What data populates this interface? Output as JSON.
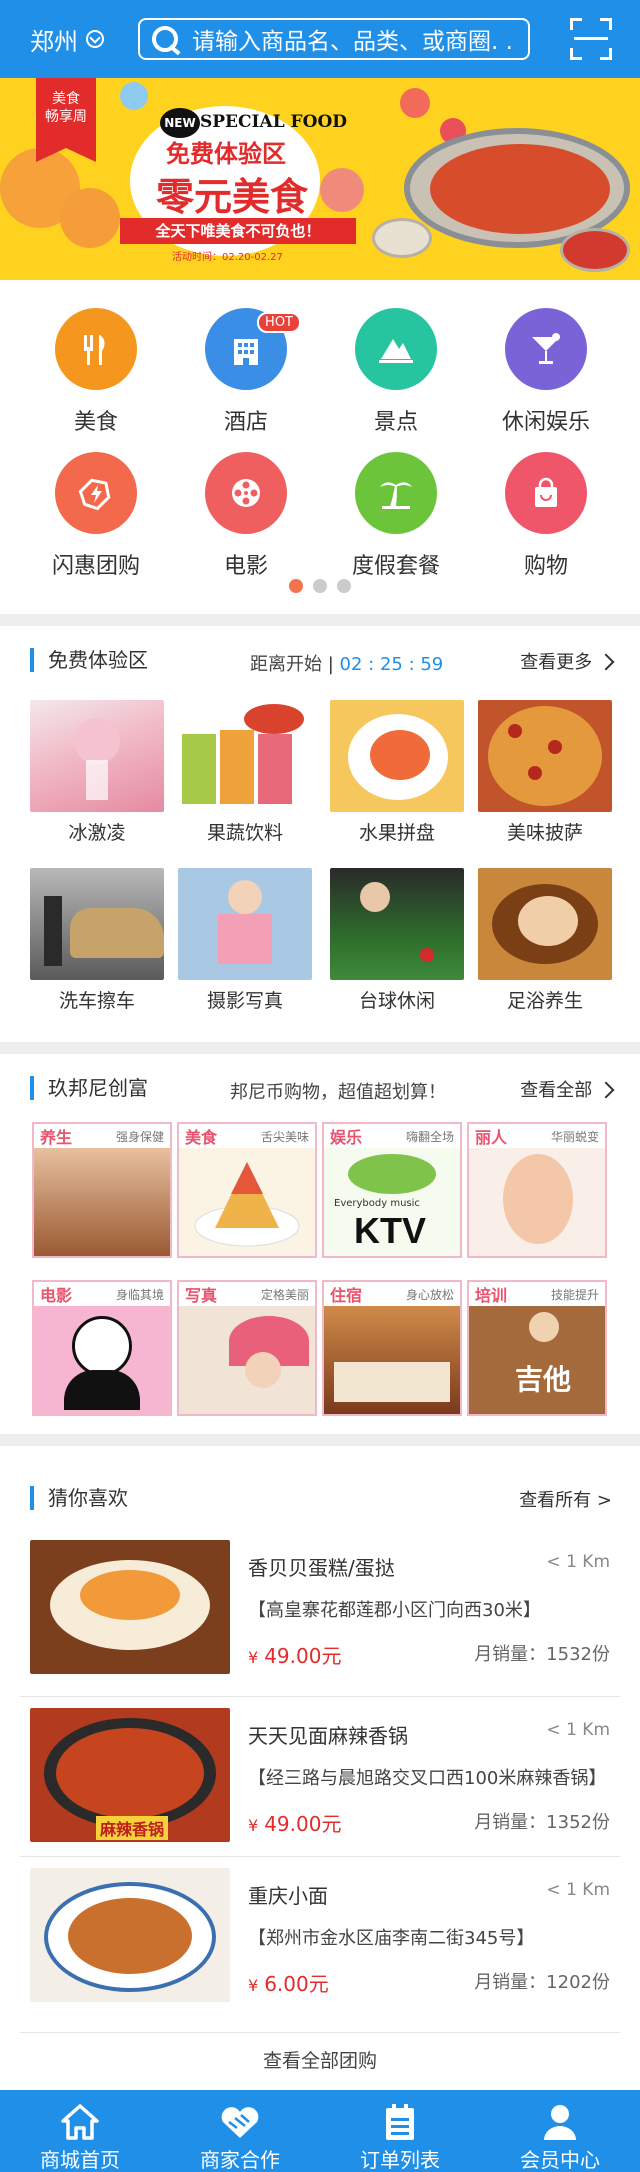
{
  "header": {
    "city": "郑州",
    "search_placeholder": "请输入商品名、品类、或商圈. . ."
  },
  "banner": {
    "tag": "美食畅享周",
    "tag_line1": "美食",
    "tag_line2": "畅享周",
    "new_badge": "NEW",
    "special": "SPECIAL FOOD",
    "free": "免费体验区",
    "headline": "零元美食",
    "ribbon": "全天下唯美食不可负也！",
    "date": "活动时间：02.20-02.27"
  },
  "categories": [
    {
      "label": "美食",
      "icon": "cutlery-icon",
      "color": "#f5961e"
    },
    {
      "label": "酒店",
      "icon": "hotel-icon",
      "color": "#3a8ee6",
      "badge": "HOT"
    },
    {
      "label": "景点",
      "icon": "scenery-icon",
      "color": "#27c4a0"
    },
    {
      "label": "休闲娱乐",
      "icon": "cocktail-icon",
      "color": "#7a63d6"
    },
    {
      "label": "闪惠团购",
      "icon": "flash-deal-icon",
      "color": "#f26a4b"
    },
    {
      "label": "电影",
      "icon": "film-reel-icon",
      "color": "#ef5f5f"
    },
    {
      "label": "度假套餐",
      "icon": "palm-tree-icon",
      "color": "#6cc43a"
    },
    {
      "label": "购物",
      "icon": "shopping-bag-icon",
      "color": "#f0566a"
    }
  ],
  "free_section": {
    "title": "免费体验区",
    "countdown_label": "距离开始",
    "countdown": "02 : 25 : 59",
    "more": "查看更多",
    "items": [
      {
        "label": "冰激凌",
        "color": "#e7a9b9"
      },
      {
        "label": "果蔬饮料",
        "color": "#f0b45a"
      },
      {
        "label": "水果拼盘",
        "color": "#f3c97a"
      },
      {
        "label": "美味披萨",
        "color": "#d86a3a"
      },
      {
        "label": "洗车擦车",
        "color": "#707276"
      },
      {
        "label": "摄影写真",
        "color": "#7aa8d8"
      },
      {
        "label": "台球休闲",
        "color": "#3b7a3a"
      },
      {
        "label": "足浴养生",
        "color": "#b5722f"
      }
    ]
  },
  "rich_section": {
    "title": "玖邦尼创富",
    "slogan": "邦尼币购物，超值超划算！",
    "more": "查看全部",
    "items": [
      {
        "title": "养生",
        "sub": "强身保健",
        "title_color": "#e8536e",
        "color": "#c98a5c"
      },
      {
        "title": "美食",
        "sub": "舌尖美味",
        "title_color": "#e8536e",
        "color": "#e9d2a0"
      },
      {
        "title": "娱乐",
        "sub": "嗨翻全场",
        "title_color": "#e8536e",
        "color": "#d7f0c8"
      },
      {
        "title": "丽人",
        "sub": "华丽蜕变",
        "title_color": "#e8536e",
        "color": "#f4c7a8"
      },
      {
        "title": "电影",
        "sub": "身临其境",
        "title_color": "#e8536e",
        "color": "#f3a6c8"
      },
      {
        "title": "写真",
        "sub": "定格美丽",
        "title_color": "#e8536e",
        "color": "#e2b3a4"
      },
      {
        "title": "住宿",
        "sub": "身心放松",
        "title_color": "#e8536e",
        "color": "#b0683a"
      },
      {
        "title": "培训",
        "sub": "技能提升",
        "title_color": "#e8536e",
        "color": "#a46a3c"
      }
    ],
    "ktv_text": "KTV",
    "ktv_small": "Everybody music",
    "guitar_text": "吉他"
  },
  "guess_section": {
    "title": "猜你喜欢",
    "more": "查看所有 >",
    "items": [
      {
        "name": "香贝贝蛋糕/蛋挞",
        "distance": "< 1 Km",
        "address": "【高皇寨花都莲郡小区门向西30米】",
        "currency": "¥",
        "price": "49.00元",
        "sales": "月销量：1532份",
        "color": "#7c3f1e"
      },
      {
        "name": "天天见面麻辣香锅",
        "distance": "< 1 Km",
        "address": "【经三路与晨旭路交叉口西100米麻辣香锅】",
        "currency": "¥",
        "price": "49.00元",
        "sales": "月销量：1352份",
        "color": "#b23a1e",
        "img_text": "麻辣香锅"
      },
      {
        "name": "重庆小面",
        "distance": "< 1 Km",
        "address": "【郑州市金水区庙李南二街345号】",
        "currency": "¥",
        "price": "6.00元",
        "sales": "月销量：1202份",
        "color": "#c9702e"
      }
    ],
    "view_all": "查看全部团购"
  },
  "tabbar": [
    {
      "label": "商城首页",
      "icon": "home-icon"
    },
    {
      "label": "商家合作",
      "icon": "handshake-icon"
    },
    {
      "label": "订单列表",
      "icon": "order-list-icon"
    },
    {
      "label": "会员中心",
      "icon": "user-icon"
    }
  ]
}
